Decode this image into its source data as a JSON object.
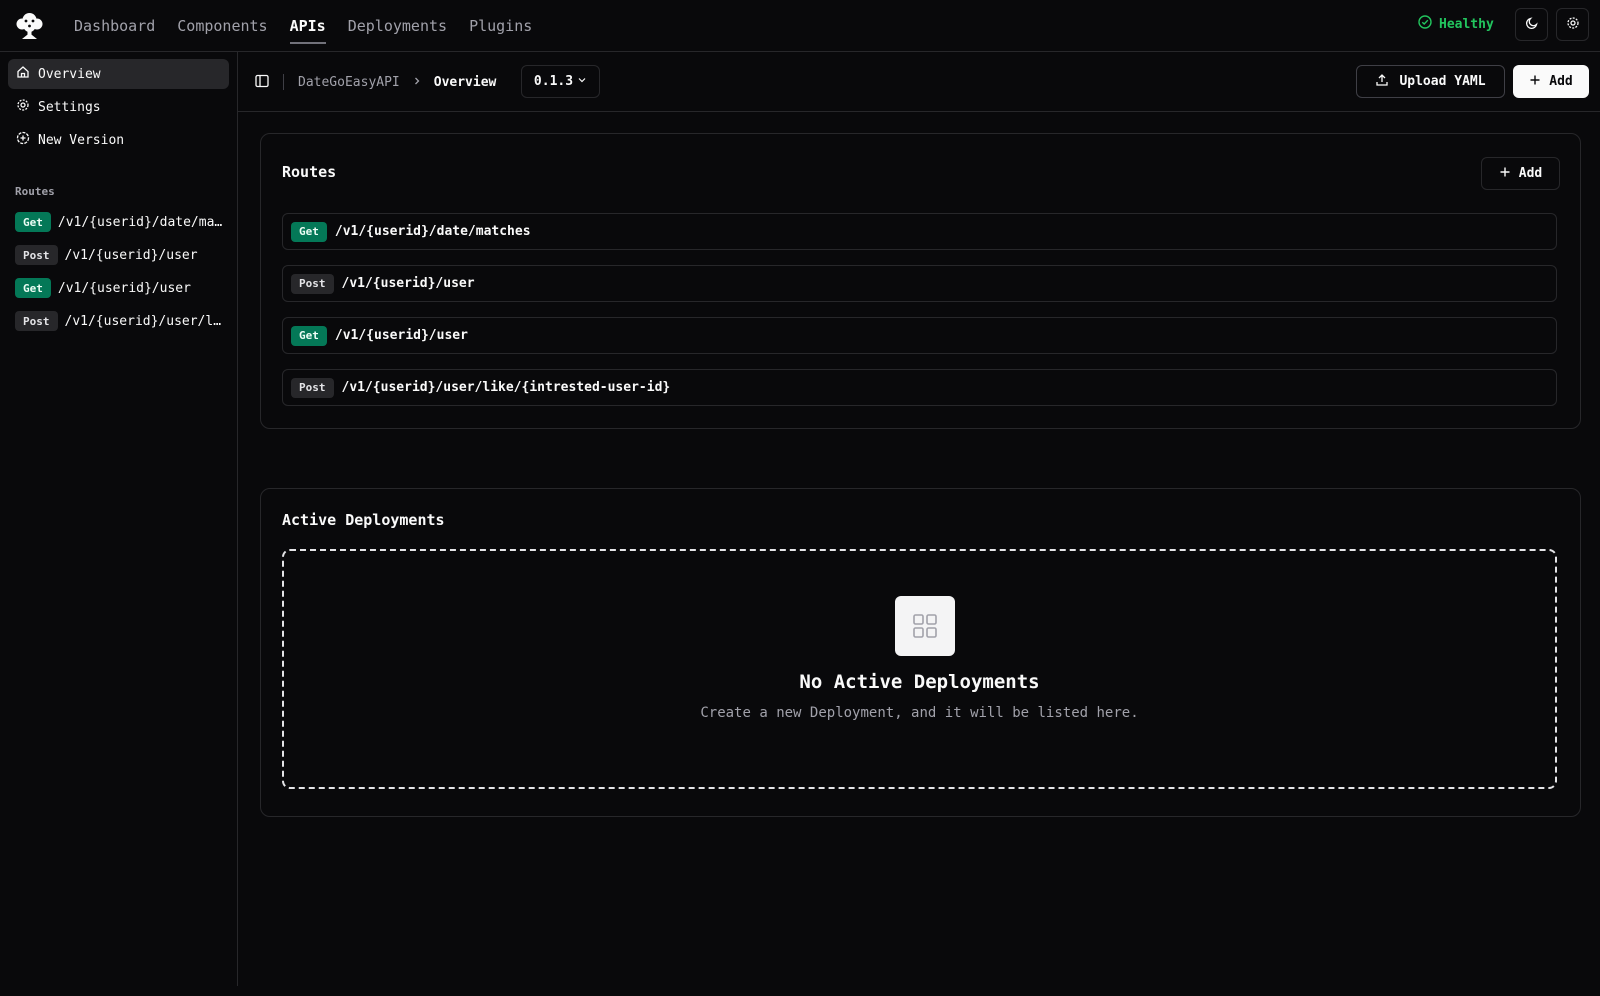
{
  "topbar": {
    "nav": [
      "Dashboard",
      "Components",
      "APIs",
      "Deployments",
      "Plugins"
    ],
    "active_nav": "APIs",
    "status": "Healthy",
    "status_color": "#22c55e"
  },
  "sidebar": {
    "items": [
      {
        "label": "Overview",
        "icon": "home-icon",
        "active": true
      },
      {
        "label": "Settings",
        "icon": "gear-icon",
        "active": false
      },
      {
        "label": "New Version",
        "icon": "plus-circle-icon",
        "active": false
      }
    ],
    "routes_heading": "Routes",
    "routes": [
      {
        "method": "Get",
        "path": "/v1/{userid}/date/matches"
      },
      {
        "method": "Post",
        "path": "/v1/{userid}/user"
      },
      {
        "method": "Get",
        "path": "/v1/{userid}/user"
      },
      {
        "method": "Post",
        "path": "/v1/{userid}/user/like/{intrested-user-id}"
      }
    ]
  },
  "subbar": {
    "breadcrumb": [
      "DateGoEasyAPI",
      "Overview"
    ],
    "version": "0.1.3",
    "upload_label": "Upload YAML",
    "add_label": "Add"
  },
  "routes_card": {
    "title": "Routes",
    "add_label": "Add",
    "routes": [
      {
        "method": "Get",
        "path": "/v1/{userid}/date/matches"
      },
      {
        "method": "Post",
        "path": "/v1/{userid}/user"
      },
      {
        "method": "Get",
        "path": "/v1/{userid}/user"
      },
      {
        "method": "Post",
        "path": "/v1/{userid}/user/like/{intrested-user-id}"
      }
    ]
  },
  "deployments_card": {
    "title": "Active Deployments",
    "empty_title": "No Active Deployments",
    "empty_subtitle": "Create a new Deployment, and it will be listed here."
  }
}
